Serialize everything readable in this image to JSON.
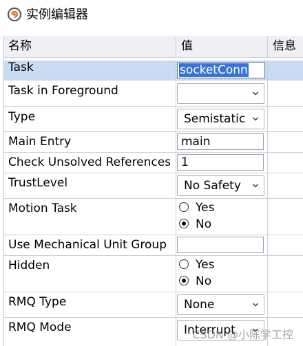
{
  "window": {
    "title": "实例编辑器",
    "icon": "app-spiral-icon"
  },
  "columns": {
    "name": "名称",
    "value": "值",
    "info": "信息"
  },
  "rows": {
    "task": {
      "label": "Task",
      "value": "socketConn"
    },
    "task_fg": {
      "label": "Task in Foreground",
      "value": ""
    },
    "type": {
      "label": "Type",
      "value": "Semistatic"
    },
    "main_entry": {
      "label": "Main Entry",
      "value": "main"
    },
    "check_unsolved": {
      "label": "Check Unsolved References",
      "value": "1"
    },
    "trust_level": {
      "label": "TrustLevel",
      "value": "No Safety"
    },
    "motion_task": {
      "label": "Motion Task",
      "opt_yes": "Yes",
      "opt_no": "No",
      "selected": "No"
    },
    "use_mech": {
      "label": "Use Mechanical Unit Group",
      "value": ""
    },
    "hidden": {
      "label": "Hidden",
      "opt_yes": "Yes",
      "opt_no": "No",
      "selected": "No"
    },
    "rmq_type": {
      "label": "RMQ Type",
      "value": "None"
    },
    "rmq_mode": {
      "label": "RMQ Mode",
      "value": "Interrupt"
    }
  },
  "watermark": "CSDN @小陈学工控",
  "colors": {
    "selected_row": "#c9dcf3",
    "highlight_text": "#3874d8",
    "grid_line": "#c9cfd8"
  }
}
